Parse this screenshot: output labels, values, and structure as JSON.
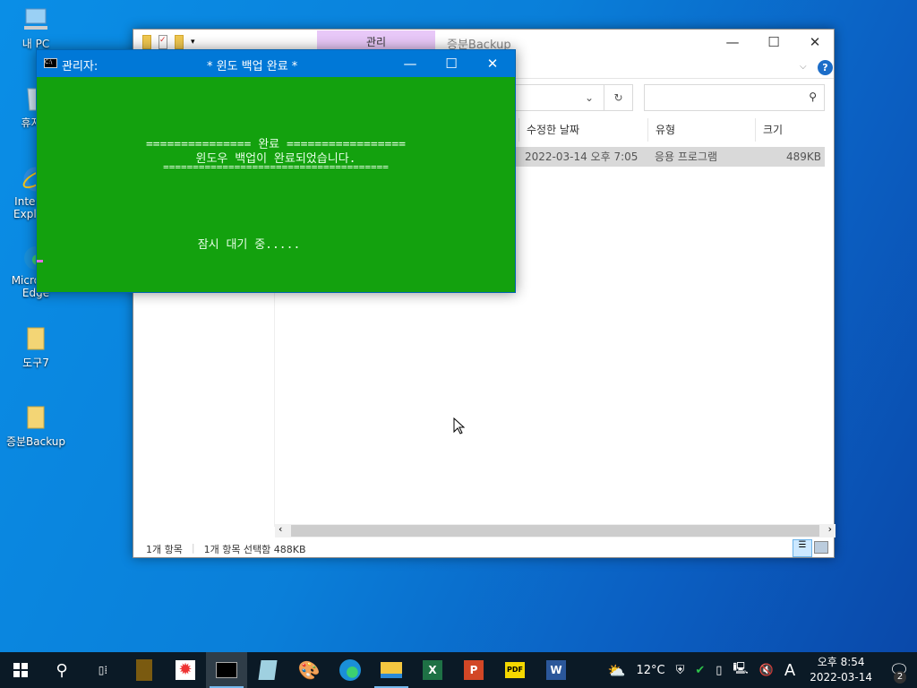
{
  "desktop": {
    "icons": [
      {
        "label": "내 PC",
        "icon": "computer-icon"
      },
      {
        "label": "휴지통",
        "icon": "recycle-bin-icon"
      },
      {
        "label": "Internet Explorer",
        "icon": "internet-explorer-icon"
      },
      {
        "label": "Microsoft Edge",
        "icon": "edge-icon"
      },
      {
        "label": "도구7",
        "icon": "folder-icon"
      },
      {
        "label": "증분Backup",
        "icon": "folder-icon"
      }
    ]
  },
  "explorer": {
    "ribbon_tab": "관리",
    "title": "증분Backup",
    "columns": [
      "수정한 날짜",
      "유형",
      "크기"
    ],
    "rows": [
      {
        "date": "2022-03-14 오후 7:05",
        "type": "응용 프로그램",
        "size": "489KB"
      }
    ],
    "status_count": "1개 항목",
    "status_selected": "1개 항목 선택함 488KB",
    "accent": "#0078d7"
  },
  "cmd": {
    "title_left": "관리자:",
    "title_center": "*  윈도 백업 완료  *",
    "line1": "=============== 완료 =================",
    "line2": "윈도우 백업이 완료되었습니다.",
    "line3": "======================================",
    "line4": "잠시 대기 중.....",
    "bg": "#13a10e"
  },
  "taskbar": {
    "apps": [
      "start",
      "search",
      "task-view",
      "app1",
      "app2",
      "cmd",
      "notepad",
      "paint",
      "edge",
      "file-explorer",
      "excel",
      "powerpoint",
      "pdf",
      "word"
    ],
    "weather": "12°C",
    "ime": "A",
    "time": "오후 8:54",
    "date": "2022-03-14",
    "notifications": "2"
  }
}
